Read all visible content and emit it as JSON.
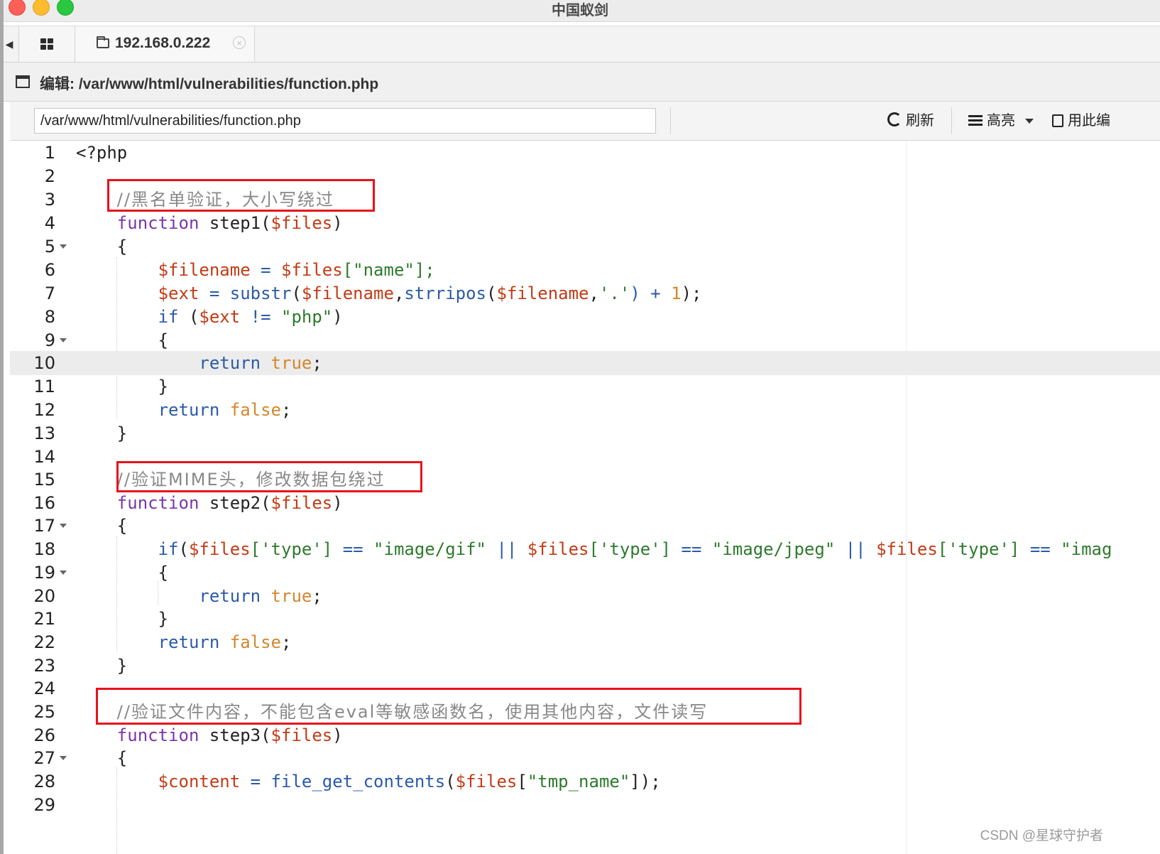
{
  "window": {
    "title": "中国蚁剑"
  },
  "tabs": {
    "host_label": "192.168.0.222",
    "close_symbol": "×"
  },
  "editor_header": {
    "title": "编辑: /var/www/html/vulnerabilities/function.php"
  },
  "toolbar": {
    "path_value": "/var/www/html/vulnerabilities/function.php",
    "refresh_label": "刷新",
    "highlight_label": "高亮",
    "open_with_label": "用此编"
  },
  "code_lines": [
    "1",
    "2",
    "3",
    "4",
    "5",
    "6",
    "7",
    "8",
    "9",
    "10",
    "11",
    "12",
    "13",
    "14",
    "15",
    "16",
    "17",
    "18",
    "19",
    "20",
    "21",
    "22",
    "23",
    "24",
    "25",
    "26",
    "27",
    "28",
    "29"
  ],
  "code": {
    "l1": "<?php",
    "l3_comment": "//黑名单验证，大小写绕过",
    "fn_keyword": "function",
    "step1": "step1(",
    "step2": "step2(",
    "step3": "step3(",
    "files_var": "$files",
    "close_paren": ")",
    "open_brace": "{",
    "close_brace": "}",
    "filename_var": "$filename",
    "eq": " = ",
    "name_key": "[\"name\"];",
    "ext_var": "$ext",
    "substr": "substr",
    "strripos": "strripos",
    "l7_mid": ",",
    "l7_dot": "'.'",
    "l7_plus": ") + ",
    "l7_one": "1",
    "l7_end": ");",
    "if_kw": "if",
    "l8_open": " (",
    "neq": " != ",
    "php_str": "\"php\"",
    "return_kw": "return",
    "true_lit": "true",
    "false_lit": "false",
    "semi": ";",
    "l15_comment": "//验证MIME头，修改数据包绕过",
    "type_key": "['type']",
    "eqeq": " == ",
    "or_op": " || ",
    "gif_str": "\"image/gif\"",
    "jpeg_str": "\"image/jpeg\"",
    "imag_str": "\"imag",
    "l25_comment": "//验证文件内容，不能包含eval等敏感函数名，使用其他内容，文件读写",
    "content_var": "$content",
    "fgc": "file_get_contents",
    "tmp_key": "\"tmp_name\"",
    "l28_end": "]);"
  },
  "watermark": "CSDN @星球守护者"
}
